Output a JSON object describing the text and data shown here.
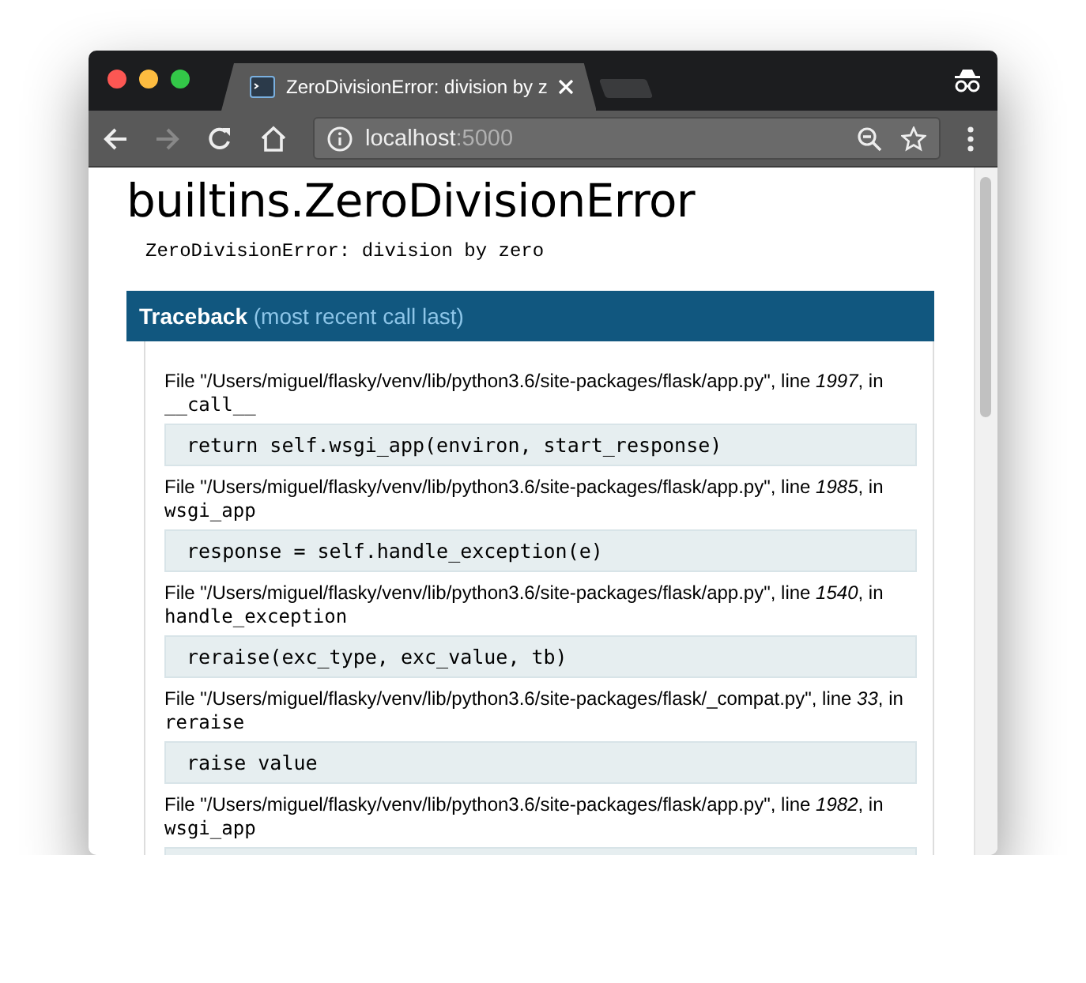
{
  "window": {
    "tab": {
      "title": "ZeroDivisionError: division by z",
      "selected": true
    },
    "address": {
      "host": "localhost",
      "port": ":5000"
    },
    "forward_disabled": true
  },
  "page": {
    "heading": "builtins.ZeroDivisionError",
    "message": "ZeroDivisionError: division by zero",
    "traceback_header": "**Traceback** (most recent call last)",
    "frames": [
      {
        "location": "File \"/Users/miguel/flasky/venv/lib/python3.6/site-packages/flask/app.py\", line *1997*, in",
        "function": "__call__",
        "code": "return self.wsgi_app(environ, start_response)"
      },
      {
        "location": "File \"/Users/miguel/flasky/venv/lib/python3.6/site-packages/flask/app.py\", line *1985*, in",
        "function": "wsgi_app",
        "code": "response = self.handle_exception(e)"
      },
      {
        "location": "File \"/Users/miguel/flasky/venv/lib/python3.6/site-packages/flask/app.py\", line *1540*, in",
        "function": "handle_exception",
        "code": "reraise(exc_type, exc_value, tb)"
      },
      {
        "location": "File \"/Users/miguel/flasky/venv/lib/python3.6/site-packages/flask/_compat.py\", line *33*, in",
        "function": "reraise",
        "code": "raise value"
      },
      {
        "location": "File \"/Users/miguel/flasky/venv/lib/python3.6/site-packages/flask/app.py\", line *1982*, in",
        "function": "wsgi_app"
      }
    ]
  }
}
